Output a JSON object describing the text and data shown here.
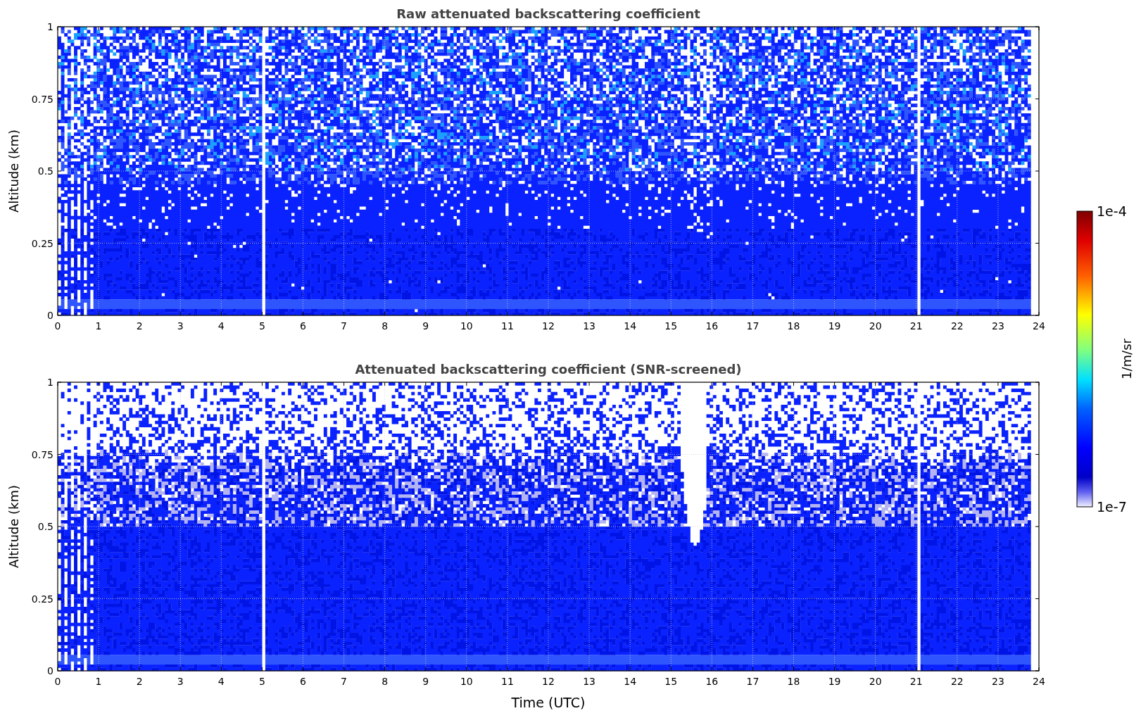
{
  "panels": [
    {
      "kind": "raw",
      "title": "Raw attenuated backscattering coefficient",
      "ylabel": "Altitude (km)",
      "yticks": [
        "1",
        "0.75",
        "0.5",
        "0.25",
        "0"
      ],
      "xticks": [
        "0",
        "1",
        "2",
        "3",
        "4",
        "5",
        "6",
        "7",
        "8",
        "9",
        "10",
        "11",
        "12",
        "13",
        "14",
        "15",
        "16",
        "17",
        "18",
        "19",
        "20",
        "21",
        "22",
        "23",
        "24"
      ]
    },
    {
      "kind": "screened",
      "title": "Attenuated backscattering coefficient (SNR-screened)",
      "ylabel": "Altitude (km)",
      "yticks": [
        "1",
        "0.75",
        "0.5",
        "0.25",
        "0"
      ],
      "xticks": [
        "0",
        "1",
        "2",
        "3",
        "4",
        "5",
        "6",
        "7",
        "8",
        "9",
        "10",
        "11",
        "12",
        "13",
        "14",
        "15",
        "16",
        "17",
        "18",
        "19",
        "20",
        "21",
        "22",
        "23",
        "24"
      ],
      "xlabel": "Time (UTC)"
    }
  ],
  "colorbar": {
    "max": "1e-4",
    "min": "1e-7",
    "label": "1/m/sr"
  }
}
